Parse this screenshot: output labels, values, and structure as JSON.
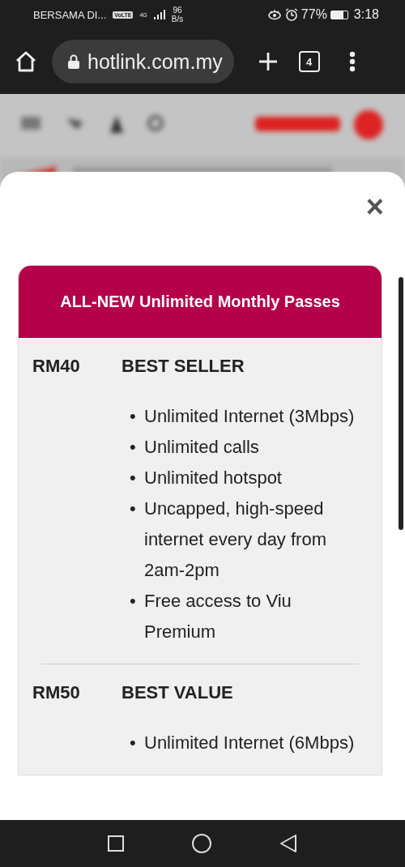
{
  "status_bar": {
    "carrier": "BERSAMA DI...",
    "volte": "VoLTE",
    "network": "4G",
    "speed": "96",
    "speed_unit": "B/s",
    "battery": "77%",
    "time": "3:18"
  },
  "browser": {
    "url": "hotlink.com.my",
    "tab_count": "4"
  },
  "modal": {
    "close": "×",
    "bullet": "•",
    "card_title": "ALL-NEW Unlimited Monthly Passes",
    "plans": [
      {
        "price": "RM40",
        "label": "BEST SELLER",
        "features": [
          "Unlimited Internet (3Mbps)",
          "Unlimited calls",
          "Unlimited hotspot",
          "Uncapped, high-speed internet every day from 2am-2pm",
          "Free access to Viu Premium"
        ]
      },
      {
        "price": "RM50",
        "label": "BEST VALUE",
        "features": [
          "Unlimited Internet (6Mbps)"
        ]
      }
    ]
  }
}
